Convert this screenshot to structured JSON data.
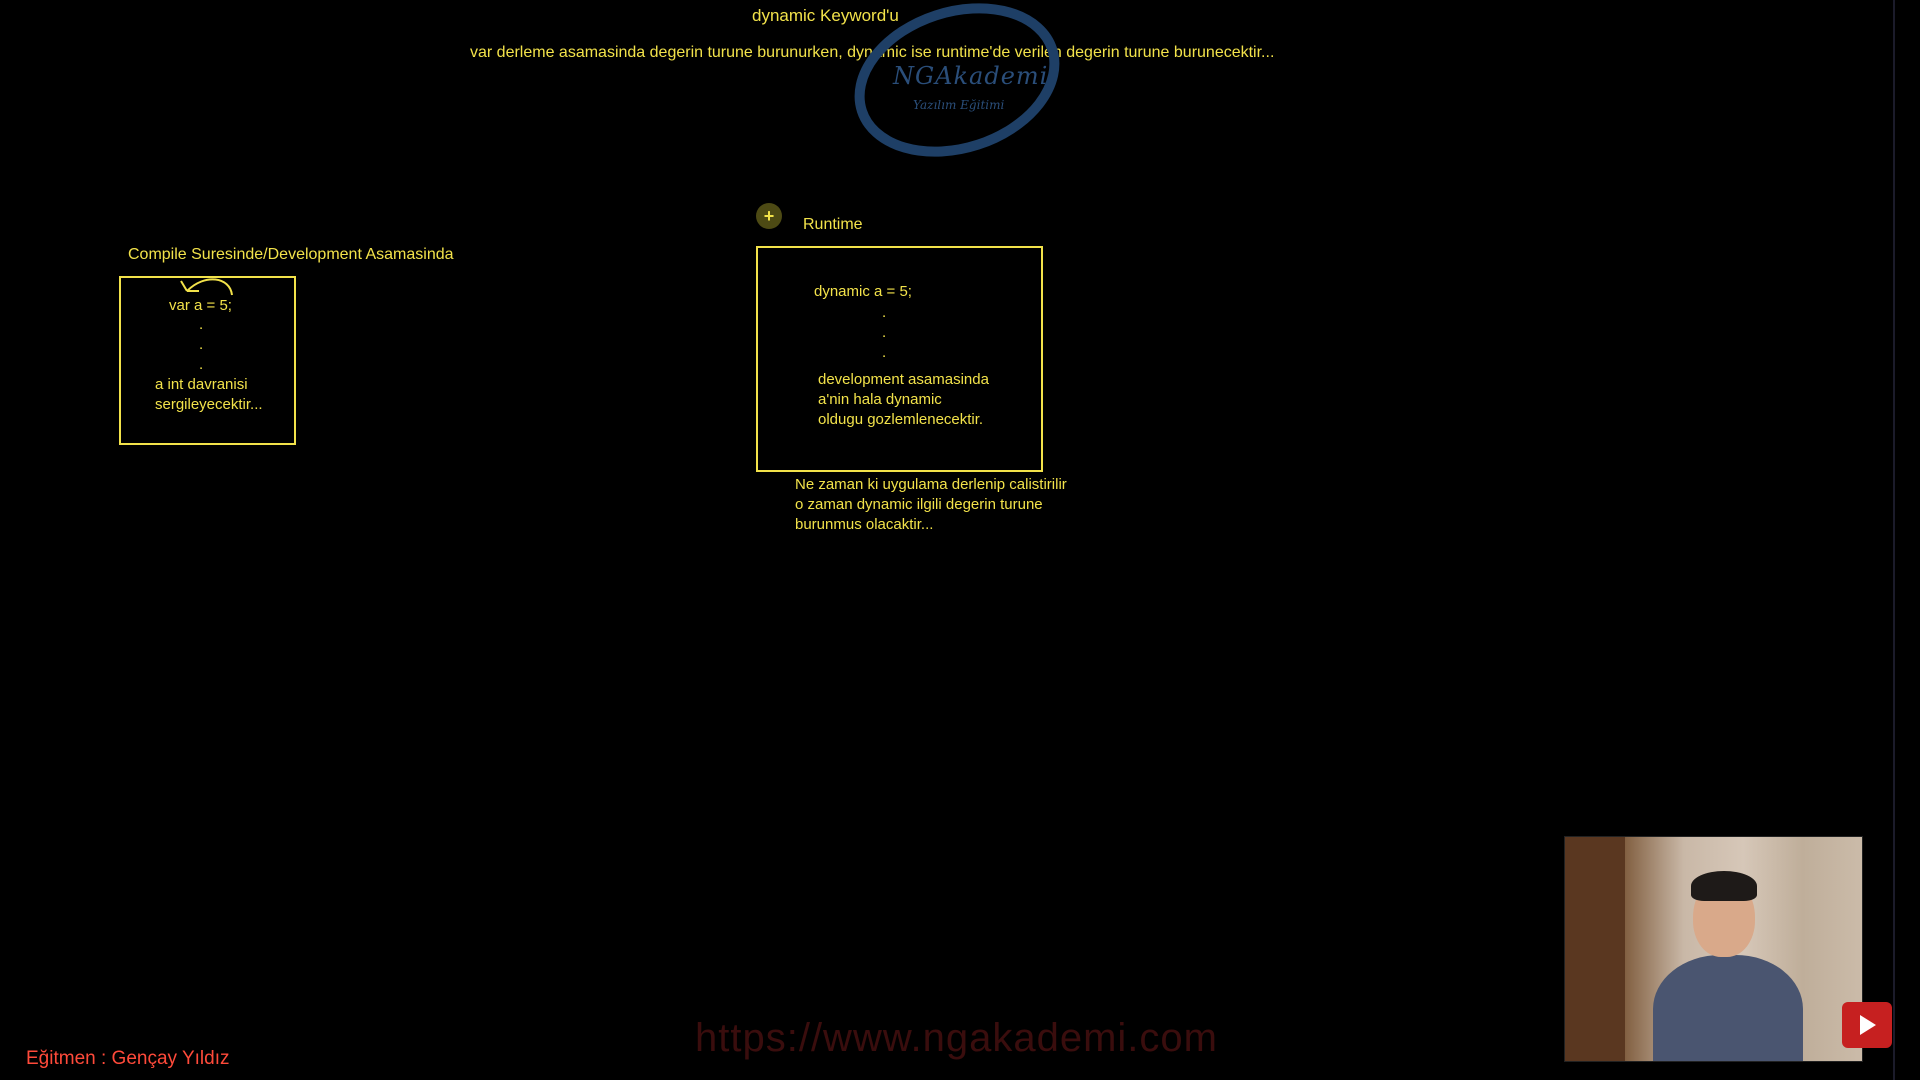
{
  "header": {
    "title": "dynamic Keyword'u",
    "subtitle": "var derleme asamasinda degerin turune burunurken, dynamic ise runtime'de verilen degerin turune burunecektir..."
  },
  "logo": {
    "name": "NGAkademi",
    "tagline": "Yazılım Eğitimi",
    "color": "#2a4e7a"
  },
  "compile_section": {
    "label": "Compile Suresinde/Development Asamasinda",
    "code": "var a = 5;",
    "dots": [
      ".",
      ".",
      "."
    ],
    "note_lines": [
      "a int davranisi",
      "sergileyecektir..."
    ]
  },
  "runtime_section": {
    "add_button": "+",
    "label": "Runtime",
    "code": "dynamic a = 5;",
    "dots": [
      ".",
      ".",
      "."
    ],
    "note_lines": [
      "development asamasinda",
      "a'nin hala dynamic",
      "oldugu gozlemlenecektir."
    ],
    "after_lines": [
      "Ne zaman ki uygulama derlenip calistirilir",
      "o zaman dynamic ilgili degerin turune",
      "burunmus olacaktir..."
    ]
  },
  "footer": {
    "website": "https://www.ngakademi.com",
    "instructor": "Eğitmen : Gençay Yıldız"
  },
  "colors": {
    "text": "#f2e24a",
    "background": "#000000",
    "instructor": "#ff4a3a",
    "youtube": "#c62020"
  },
  "icons": {
    "plus": "plus-icon",
    "youtube": "youtube-play-icon"
  }
}
